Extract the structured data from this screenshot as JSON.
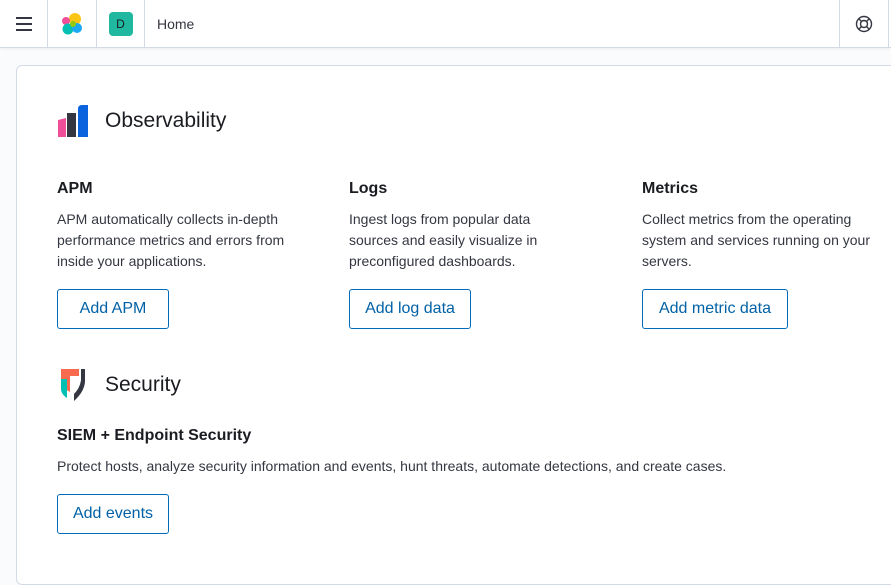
{
  "header": {
    "space_initial": "D",
    "breadcrumb": "Home"
  },
  "observability": {
    "title": "Observability",
    "columns": [
      {
        "title": "APM",
        "description": "APM automatically collects in-depth performance metrics and errors from inside your applications.",
        "button": "Add APM"
      },
      {
        "title": "Logs",
        "description": "Ingest logs from popular data sources and easily visualize in preconfigured dashboards.",
        "button": "Add log data"
      },
      {
        "title": "Metrics",
        "description": "Collect metrics from the operating system and services running on your servers.",
        "button": "Add metric data"
      }
    ]
  },
  "security": {
    "title": "Security",
    "subtitle": "SIEM + Endpoint Security",
    "description": "Protect hosts, analyze security information and events, hunt threats, automate detections, and create cases.",
    "button": "Add events"
  },
  "colors": {
    "accent": "#006bb8",
    "space_avatar": "#20b9a0"
  },
  "icons": [
    "hamburger-menu-icon",
    "elastic-logo-icon",
    "help-lifebuoy-icon",
    "observability-logo-icon",
    "security-logo-icon"
  ]
}
